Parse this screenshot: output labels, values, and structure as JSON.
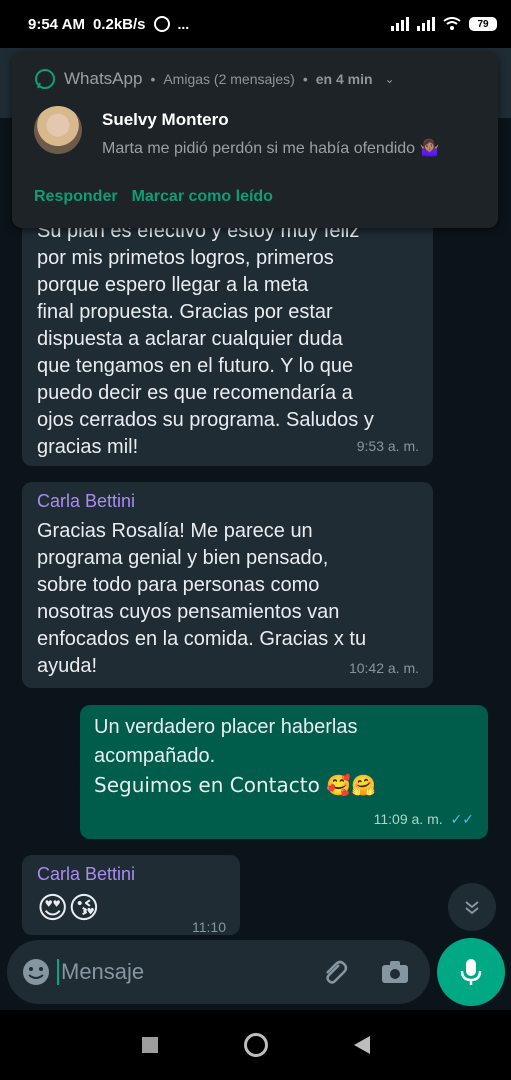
{
  "status_bar": {
    "time": "9:54 AM",
    "speed": "0.2kB/s",
    "extra": "...",
    "battery": "79"
  },
  "notification": {
    "app": "WhatsApp",
    "group": "Amigas (2 mensajes)",
    "time_text": "en 4 min",
    "sender": "Suelvy Montero",
    "message": "Marta me pidió perdón si me había ofendido 🤷🏽‍♀️",
    "actions": [
      "Responder",
      "Marcar como leído"
    ]
  },
  "messages": [
    {
      "type": "in",
      "text_lines": [
        "Su plan es efectivo y estoy muy feliz",
        "por mis primetos logros, primeros",
        "porque espero llegar a la meta",
        "final propuesta. Gracias por estar",
        "dispuesta a aclarar cualquier duda",
        "que tengamos en el futuro. Y lo que",
        "puedo decir es que recomendaría a",
        "ojos cerrados su programa. Saludos y",
        "gracias mil!"
      ],
      "time": "9:53 a. m."
    },
    {
      "type": "in",
      "sender": "Carla Bettini",
      "text_lines": [
        "Gracias Rosalía! Me parece un",
        "programa genial y bien pensado,",
        "sobre todo para personas como",
        "nosotras cuyos pensamientos van",
        "enfocados en la comida. Gracias x tu",
        "ayuda!"
      ],
      "time": "10:42 a. m."
    },
    {
      "type": "out",
      "text_lines": [
        "Un verdadero placer haberlas",
        "acompañado.",
        "Seguimos en Contacto 🥰🤗"
      ],
      "time": "11:09 a. m.",
      "ticks": "✓✓"
    },
    {
      "type": "in",
      "sender": "Carla Bettini",
      "text": "😍😘",
      "time": "11:10"
    }
  ],
  "input": {
    "placeholder": "Mensaje"
  },
  "colors": {
    "accent": "#00a884",
    "incoming_bubble": "#1f2c34",
    "outgoing_bubble": "#005c4b",
    "sender_name": "#a98cf0",
    "background": "#0b141a"
  },
  "icons": [
    "whatsapp-icon",
    "emoji-icon",
    "attach-icon",
    "camera-icon",
    "mic-icon",
    "chevron-down-icon",
    "nav-square-icon",
    "nav-circle-icon",
    "nav-back-icon"
  ]
}
